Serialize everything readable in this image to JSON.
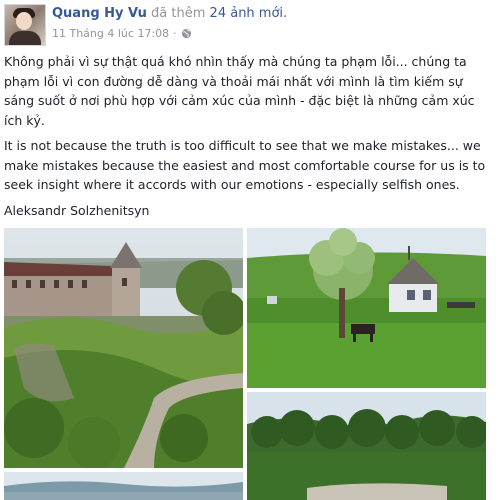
{
  "post": {
    "author": "Quang Hy Vu",
    "action": "đã thêm",
    "action_link": "24 ảnh mới.",
    "timestamp": "11 Tháng 4 lúc 17:08",
    "separator": "·",
    "privacy_icon": "globe-icon",
    "paragraphs": [
      "Không phải vì sự thật quá khó nhìn thấy mà chúng ta phạm lỗi... chúng ta phạm lỗi vì con đường dễ dàng và thoải mái nhất với mình là tìm kiếm sự sáng suốt ở nơi phù hợp với cảm xúc của mình - đặc biệt là những cảm xúc ích kỷ.",
      "It is not because the truth is too difficult to see that we make mistakes... we make mistakes because the easiest and most comfortable course for us is to seek insight where it accords with our emotions - especially selfish ones.",
      "Aleksandr Solzhenitsyn"
    ]
  },
  "colors": {
    "link": "#365899",
    "meta": "#90949c",
    "text": "#1d2129"
  }
}
